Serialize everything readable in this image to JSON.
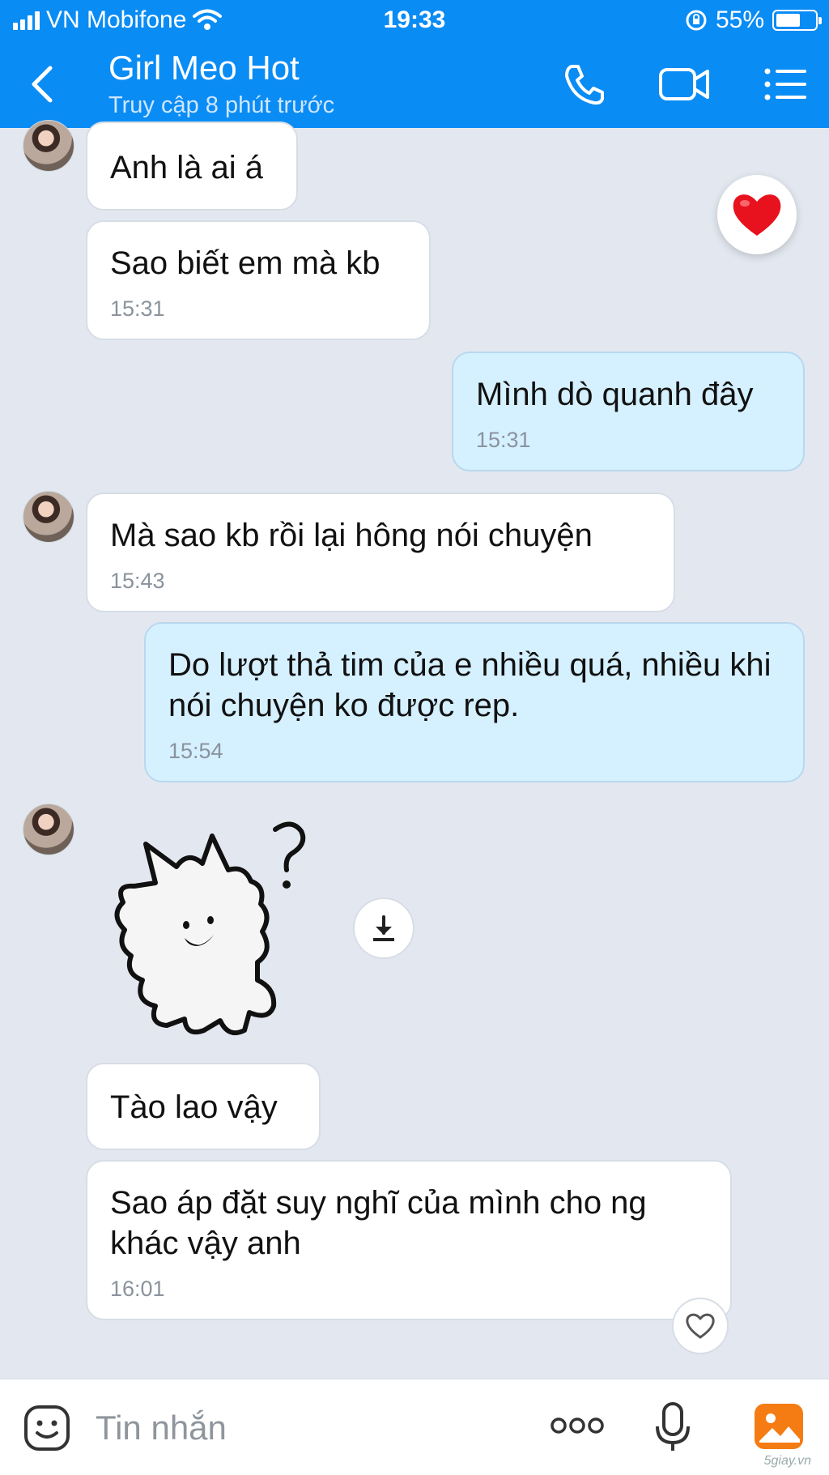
{
  "status_bar": {
    "carrier": "VN Mobifone",
    "time": "19:33",
    "battery": "55%"
  },
  "header": {
    "title": "Girl Meo Hot",
    "subtitle": "Truy cập 8 phút trước"
  },
  "messages": [
    {
      "from": "them",
      "text": "Anh là ai á",
      "time": ""
    },
    {
      "from": "them",
      "text": "Sao biết em mà kb",
      "time": "15:31"
    },
    {
      "from": "me",
      "text": "Mình dò quanh đây",
      "time": "15:31"
    },
    {
      "from": "them",
      "text": "Mà sao kb rồi lại hông nói chuyện",
      "time": "15:43"
    },
    {
      "from": "me",
      "text": "Do lượt thả tim của e nhiều quá, nhiều khi nói chuyện ko được rep.",
      "time": "15:54"
    },
    {
      "from": "them",
      "text": "Tào lao vậy",
      "time": ""
    },
    {
      "from": "them",
      "text": "Sao áp đặt suy nghĩ của mình cho ng khác vậy anh",
      "time": "16:01"
    }
  ],
  "composer": {
    "placeholder": "Tin nhắn"
  },
  "watermark": "5giay.vn",
  "colors": {
    "header_blue": "#0a8cf5",
    "my_bubble": "#d5f0ff",
    "their_bubble": "#ffffff",
    "chat_background": "#e3e8f0"
  },
  "icons": [
    "back-icon",
    "phone-icon",
    "video-call-icon",
    "menu-list-icon",
    "heart-reaction-icon",
    "download-icon",
    "like-heart-icon",
    "emoji-icon",
    "more-icon",
    "microphone-icon",
    "image-icon"
  ]
}
